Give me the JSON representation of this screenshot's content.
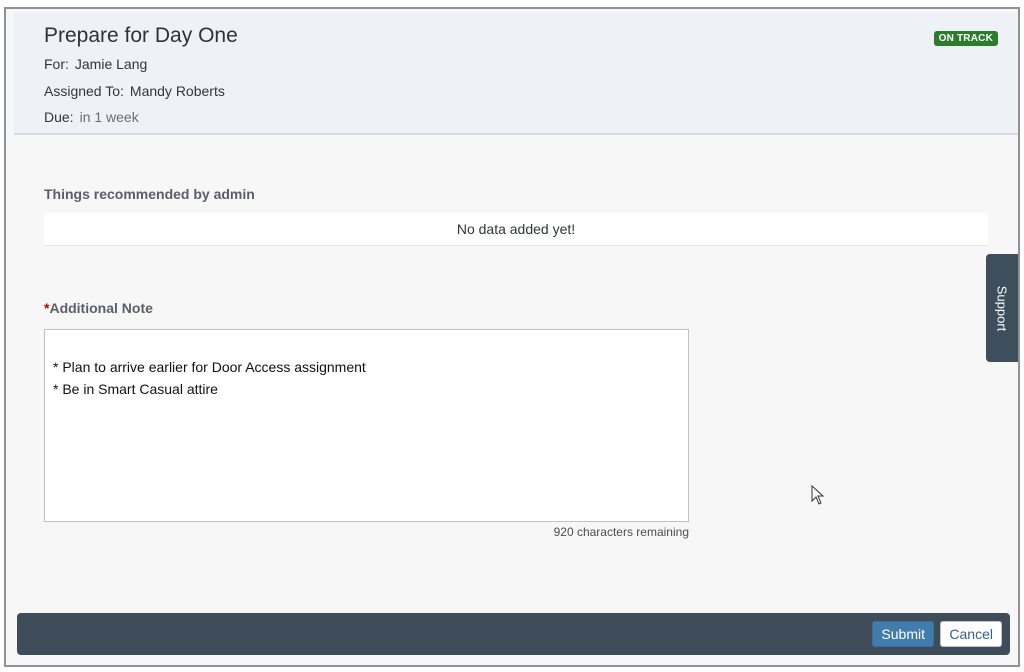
{
  "header": {
    "title": "Prepare for Day One",
    "for_label": "For:",
    "for_value": "Jamie Lang",
    "assigned_label": "Assigned To:",
    "assigned_value": "Mandy Roberts",
    "due_label": "Due:",
    "due_value": "in 1 week",
    "status_badge": "ON TRACK",
    "status_color": "#2b7d2b"
  },
  "recommended": {
    "title": "Things recommended by admin",
    "empty_text": "No data added yet!"
  },
  "note": {
    "required_marker": "*",
    "label": "Additional Note",
    "lines": [
      "* Plan to arrive earlier for Door Access assignment",
      "* Be in Smart Casual attire"
    ],
    "chars_remaining": "920 characters remaining"
  },
  "support_tab": {
    "label": "Support"
  },
  "footer": {
    "submit_label": "Submit",
    "cancel_label": "Cancel",
    "submit_color": "#427cac"
  }
}
